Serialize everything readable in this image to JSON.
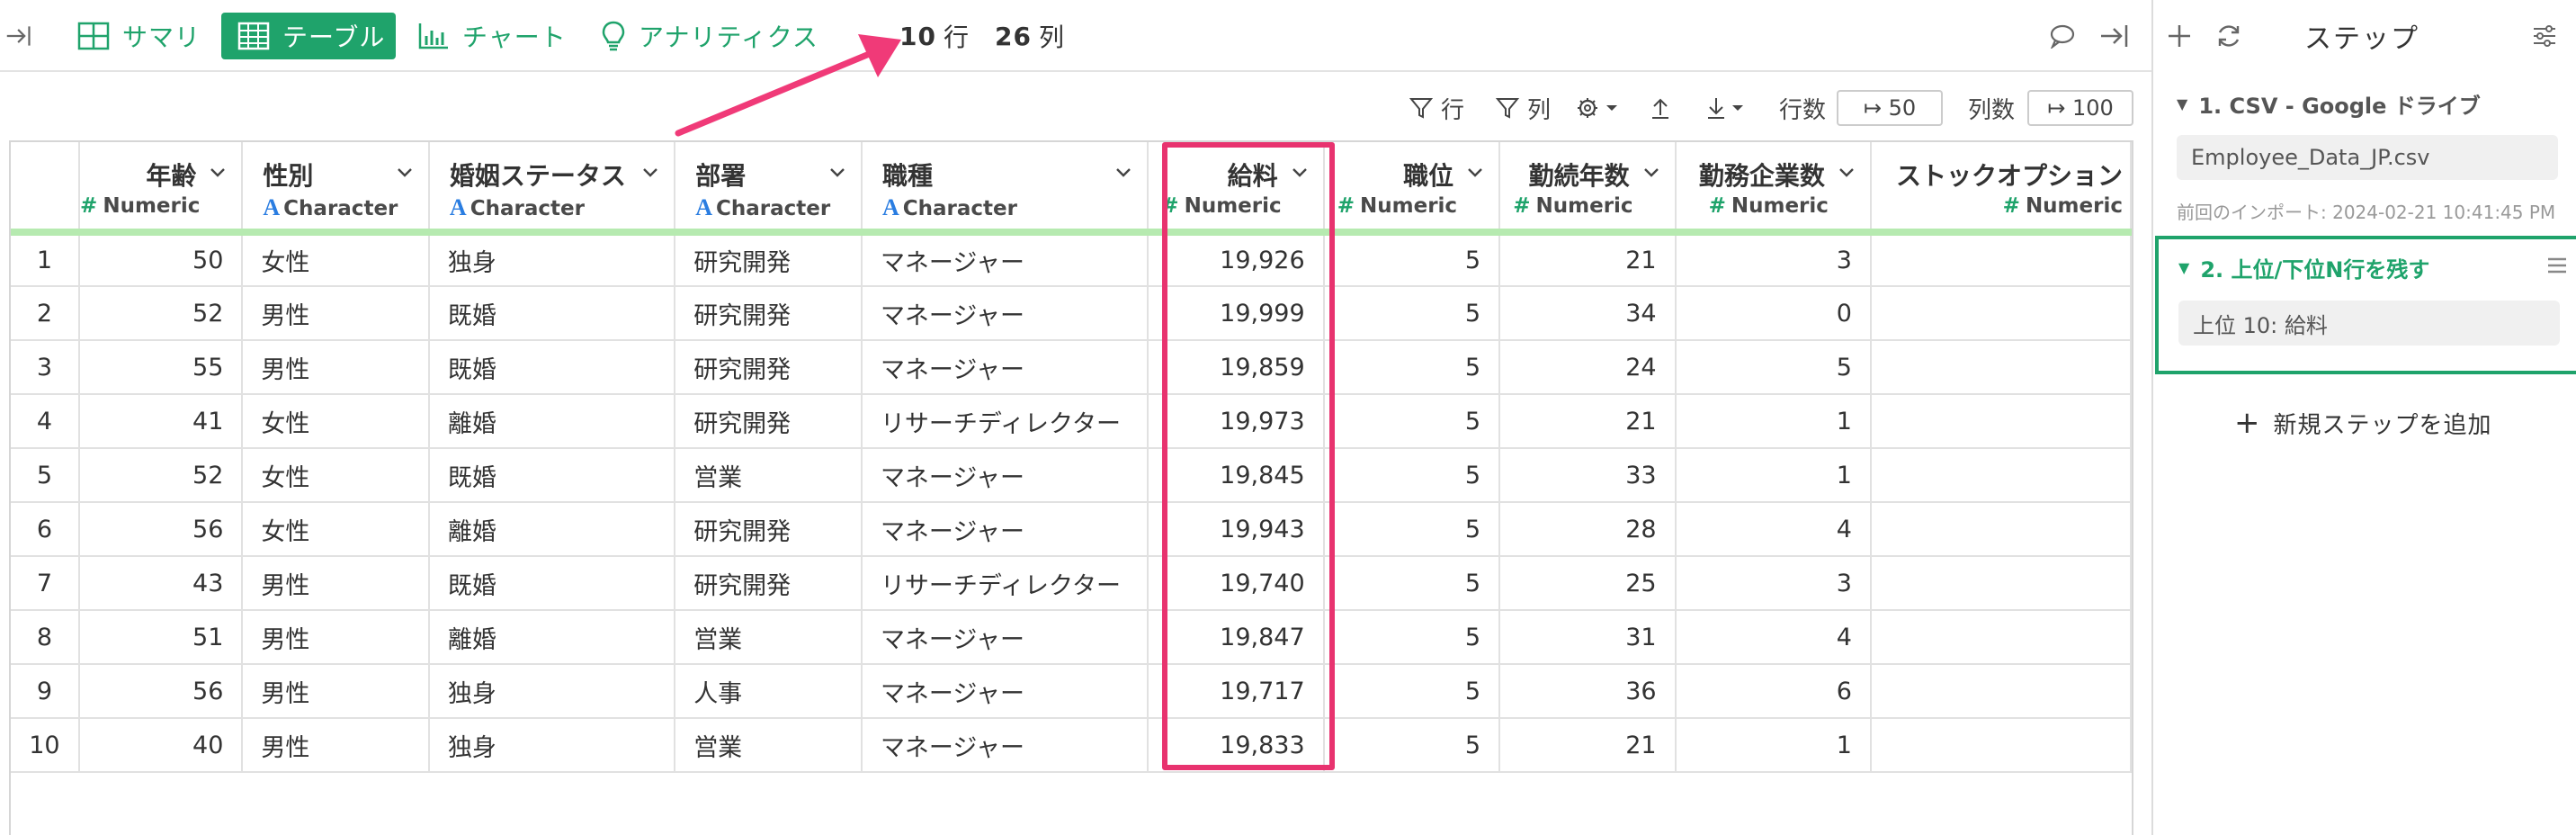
{
  "topbar": {
    "summary_label": "サマリ",
    "table_label": "テーブル",
    "chart_label": "チャート",
    "analytics_label": "アナリティクス",
    "row_count": "10",
    "row_unit": "行",
    "col_count": "26",
    "col_unit": "列"
  },
  "toolbar": {
    "row_filter_label": "行",
    "col_filter_label": "列",
    "rows_label": "行数",
    "rows_value": "↦ 50",
    "cols_label": "列数",
    "cols_value": "↦ 100"
  },
  "table": {
    "columns": [
      {
        "name": "年齢",
        "type": "Numeric"
      },
      {
        "name": "性別",
        "type": "Character"
      },
      {
        "name": "婚姻ステータス",
        "type": "Character"
      },
      {
        "name": "部署",
        "type": "Character"
      },
      {
        "name": "職種",
        "type": "Character"
      },
      {
        "name": "給料",
        "type": "Numeric"
      },
      {
        "name": "職位",
        "type": "Numeric"
      },
      {
        "name": "勤続年数",
        "type": "Numeric"
      },
      {
        "name": "勤務企業数",
        "type": "Numeric"
      },
      {
        "name": "ストックオプション",
        "type": "Numeric"
      }
    ],
    "rows": [
      [
        "1",
        "50",
        "女性",
        "独身",
        "研究開発",
        "マネージャー",
        "19,926",
        "5",
        "21",
        "3",
        ""
      ],
      [
        "2",
        "52",
        "男性",
        "既婚",
        "研究開発",
        "マネージャー",
        "19,999",
        "5",
        "34",
        "0",
        ""
      ],
      [
        "3",
        "55",
        "男性",
        "既婚",
        "研究開発",
        "マネージャー",
        "19,859",
        "5",
        "24",
        "5",
        ""
      ],
      [
        "4",
        "41",
        "女性",
        "離婚",
        "研究開発",
        "リサーチディレクター",
        "19,973",
        "5",
        "21",
        "1",
        ""
      ],
      [
        "5",
        "52",
        "女性",
        "既婚",
        "営業",
        "マネージャー",
        "19,845",
        "5",
        "33",
        "1",
        ""
      ],
      [
        "6",
        "56",
        "女性",
        "離婚",
        "研究開発",
        "マネージャー",
        "19,943",
        "5",
        "28",
        "4",
        ""
      ],
      [
        "7",
        "43",
        "男性",
        "既婚",
        "研究開発",
        "リサーチディレクター",
        "19,740",
        "5",
        "25",
        "3",
        ""
      ],
      [
        "8",
        "51",
        "男性",
        "離婚",
        "営業",
        "マネージャー",
        "19,847",
        "5",
        "31",
        "4",
        ""
      ],
      [
        "9",
        "56",
        "男性",
        "独身",
        "人事",
        "マネージャー",
        "19,717",
        "5",
        "36",
        "6",
        ""
      ],
      [
        "10",
        "40",
        "男性",
        "独身",
        "営業",
        "マネージャー",
        "19,833",
        "5",
        "21",
        "1",
        ""
      ]
    ]
  },
  "steps": {
    "title": "ステップ",
    "step1_title": "1. CSV - Google ドライブ",
    "step1_file": "Employee_Data_JP.csv",
    "step1_meta": "前回のインポート: 2024-02-21 10:41:45 PM",
    "step2_title": "2. 上位/下位N行を残す",
    "step2_detail": "上位 10: 給料",
    "add_step_label": "新規ステップを追加"
  },
  "colors": {
    "accent": "#1fa36b",
    "highlight": "#e8336f",
    "type_bar": "#b6eab0"
  }
}
